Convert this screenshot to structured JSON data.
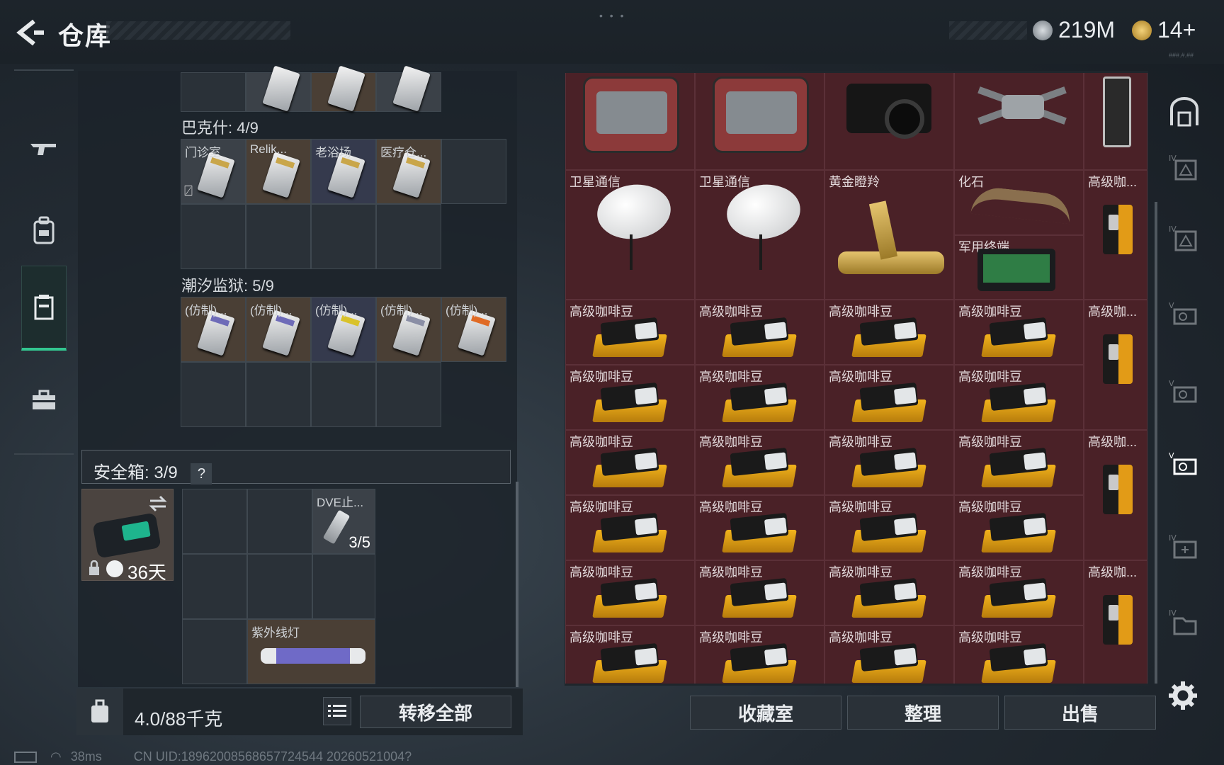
{
  "header": {
    "title": "仓库",
    "handle": "• • •",
    "build_tag": "###.#.##"
  },
  "currency": {
    "silver": "219M",
    "gold": "14+"
  },
  "colors": {
    "accent_green": "#33c690",
    "stash_bg": "#4a2127",
    "panel_bg": "#1f262c"
  },
  "left_nav": [
    {
      "name": "weapon-tab",
      "icon": "rifle-icon"
    },
    {
      "name": "backpack-tab",
      "icon": "backpack-icon"
    },
    {
      "name": "container-tab",
      "icon": "container-icon",
      "active": true
    },
    {
      "name": "toolbox-tab",
      "icon": "toolbox-icon"
    }
  ],
  "containers": [
    {
      "label": "巴克什: 4/9",
      "items": [
        "门诊室",
        "Relik...",
        "老浴场",
        "医疗仓..."
      ]
    },
    {
      "label": "潮汐监狱: 5/9",
      "items": [
        "(仿制)...",
        "(仿制)...",
        "(仿制)...",
        "(仿制)...",
        "(仿制)..."
      ]
    }
  ],
  "safe_box": {
    "label": "安全箱: 3/9",
    "help": "?",
    "days": "36天",
    "item_dve": "DVE止...",
    "item_dve_count": "3/5",
    "item_uv": "紫外线灯"
  },
  "bottom": {
    "weight": "4.0/88千克",
    "transfer_all": "转移全部"
  },
  "status": {
    "ping": "38ms",
    "uid": "CN UID:18962008568657724544 20260521004?"
  },
  "stash": {
    "row2": [
      "卫星通信",
      "卫星通信",
      "黄金瞪羚",
      "化石",
      "高级咖...",
      "军用终端"
    ],
    "coffee_label": "高级咖啡豆",
    "coffee_short": "高级咖..."
  },
  "actions": {
    "collection": "收藏室",
    "organize": "整理",
    "sell": "出售"
  },
  "right_nav": [
    "vault-icon",
    "warehouse-iv-1-icon",
    "warehouse-iv-2-icon",
    "warehouse-v-1-icon",
    "warehouse-v-2-icon",
    "warehouse-v-3-icon",
    "warehouse-iv-3-icon",
    "warehouse-iv-4-icon"
  ]
}
